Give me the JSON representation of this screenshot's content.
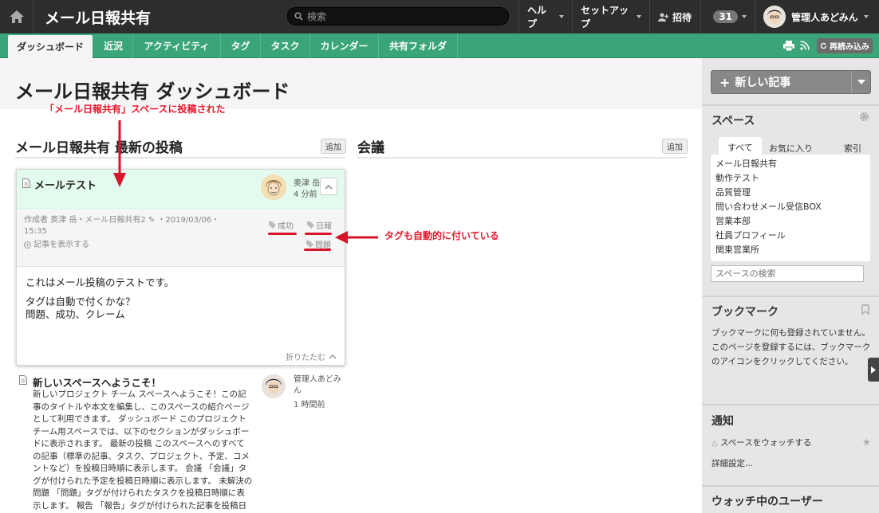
{
  "app": {
    "brand": "メール日報共有",
    "search_placeholder": "検索"
  },
  "topnav": {
    "help": "ヘルプ",
    "setup": "セットアップ",
    "invite": "招待",
    "notifications": "31",
    "user": "管理人あどみん"
  },
  "tabs": [
    "ダッシュボード",
    "近況",
    "アクティビティ",
    "タグ",
    "タスク",
    "カレンダー",
    "共有フォルダ"
  ],
  "toolbar": {
    "refresh": "再読み込み"
  },
  "page": {
    "title": "メール日報共有 ダッシュボード"
  },
  "sections": {
    "latest": "メール日報共有 最新の投稿",
    "latest_add": "追加",
    "meeting": "会議",
    "meeting_add": "追加"
  },
  "card": {
    "title": "メールテスト",
    "author": "奥津 岳",
    "time": "4 分前",
    "meta": "作成者 奥津 岳・メール日報共有2 ✎ ・2019/03/06・15:35",
    "show_article": "記事を表示する",
    "tags": [
      "成功",
      "日報",
      "問題"
    ],
    "body": [
      "これはメール投稿のテストです。",
      "タグは自動で付くかな？",
      "問題、成功、クレーム"
    ],
    "fold": "折りたたむ"
  },
  "post2": {
    "title": "新しいスペースへようこそ！",
    "author": "管理人あどみん",
    "time": "1 時間前",
    "body": "新しいプロジェクト チーム スペースへようこそ！この記事のタイトルや本文を編集し、このスペースの紹介ページとして利用できます。 ダッシュボード このプロジェクト チーム用スペースでは、以下のセクションがダッシュボードに表示されます。 最新の投稿 このスペースへのすべての記事（標準の記事、タスク、プロジェクト、予定、コメントなど）を投稿日時順に表示します。 会議 「会議」タグが付けられた予定を投稿日時順に表示します。 未解決の問題 「問題」タグが付けられたタスクを投稿日時順に表示します。 報告 「報告」タグが付けられた記事を投稿日時順に表示します。 最新の工"
  },
  "annotations": {
    "posted": "「メール日報共有」スペースに投稿された",
    "tags": "タグも自動的に付いている"
  },
  "sidebar": {
    "new_post": "新しい記事",
    "spaces_title": "スペース",
    "tab_all": "すべて",
    "tab_fav": "お気に入り",
    "tab_index": "索引",
    "spaces": [
      "メール日報共有",
      "動作テスト",
      "品質管理",
      "問い合わせメール受信BOX",
      "営業本部",
      "社員プロフィール",
      "関東営業所"
    ],
    "space_search_placeholder": "スペースの検索",
    "bookmarks_title": "ブックマーク",
    "bookmarks_text": "ブックマークに何も登録されていません。このページを登録するには、ブックマークのアイコンをクリックしてください。",
    "notify_title": "通知",
    "watch_space": "スペースをウォッチする",
    "detail_settings": "詳細設定...",
    "watchers_title": "ウォッチ中のユーザー"
  }
}
